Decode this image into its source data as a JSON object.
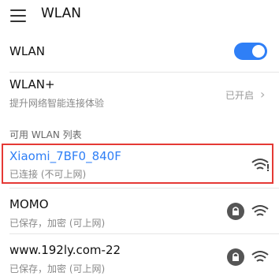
{
  "header": {
    "title": "WLAN",
    "menu_icon": "menu-icon"
  },
  "wlan_toggle": {
    "label": "WLAN",
    "state": "on",
    "accent": "#2f7ff6"
  },
  "wlan_plus": {
    "label": "WLAN+",
    "subtitle": "提升网络智能连接体验",
    "status": "已开启",
    "chevron": "›"
  },
  "section_title": "可用 WLAN 列表",
  "networks": [
    {
      "name": "Xiaomi_7BF0_840F",
      "status": "已连接 (不可上网)",
      "selected": true,
      "icon": "wifi-warning-icon"
    },
    {
      "name": "MOMO",
      "status": "已保存，加密 (可上网)",
      "selected": false,
      "icon": "wifi-icon",
      "badge_icon": "lock-icon"
    },
    {
      "name": "www.192ly.com-22",
      "status": "已保存，加密 (可上网)",
      "selected": false,
      "icon": "wifi-icon",
      "badge_icon": "lock-icon"
    }
  ],
  "colors": {
    "selected_border": "#e53935",
    "selected_text": "#2f7ff6"
  }
}
